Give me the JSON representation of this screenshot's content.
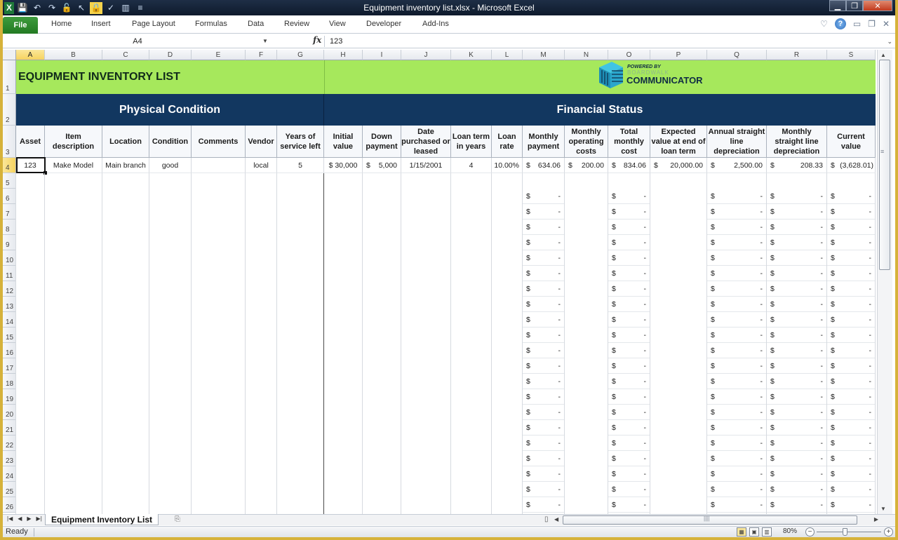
{
  "window": {
    "title": "Equipment inventory list.xlsx  -  Microsoft Excel",
    "controls": [
      "minimize",
      "maximize",
      "close"
    ]
  },
  "quick_access": [
    {
      "name": "excel-logo",
      "glyph": "X"
    },
    {
      "name": "save-icon",
      "glyph": "▪"
    },
    {
      "name": "undo-icon",
      "glyph": "↶"
    },
    {
      "name": "redo-icon",
      "glyph": "↷"
    },
    {
      "name": "lock-icon",
      "glyph": "🔒"
    },
    {
      "name": "pointer-icon",
      "glyph": "↖"
    },
    {
      "name": "lock-highlight-icon",
      "glyph": "🔒"
    },
    {
      "name": "brush-icon",
      "glyph": "✓"
    },
    {
      "name": "chart-icon",
      "glyph": "▥"
    },
    {
      "name": "customize-icon",
      "glyph": "≡"
    }
  ],
  "ribbon": {
    "file": "File",
    "tabs": [
      "Home",
      "Insert",
      "Page Layout",
      "Formulas",
      "Data",
      "Review",
      "View",
      "Developer",
      "Add-Ins"
    ]
  },
  "formula_bar": {
    "name_box": "A4",
    "fx": "fx",
    "value": "123"
  },
  "columns": [
    "A",
    "B",
    "C",
    "D",
    "E",
    "F",
    "G",
    "H",
    "I",
    "J",
    "K",
    "L",
    "M",
    "N",
    "O",
    "P",
    "Q",
    "R",
    "S"
  ],
  "selected_column": "A",
  "selected_row": 4,
  "rows_visible": [
    1,
    2,
    3,
    4,
    5,
    6,
    7,
    8,
    9,
    10,
    11,
    12,
    13,
    14,
    15,
    16,
    17,
    18,
    19,
    20,
    21,
    22,
    23,
    24,
    25,
    26
  ],
  "sheet": {
    "title": "EQUIPMENT INVENTORY LIST",
    "logo": {
      "powered_by": "POWERED BY",
      "brand": "BOARDWALK",
      "product": "COMMUNICATOR"
    },
    "section_physical": "Physical Condition",
    "section_financial": "Financial Status",
    "headers": [
      "Asset",
      "Item description",
      "Location",
      "Condition",
      "Comments",
      "Vendor",
      "Years of service left",
      "Initial value",
      "Down payment",
      "Date purchased or leased",
      "Loan term in years",
      "Loan rate",
      "Monthly payment",
      "Monthly operating costs",
      "Total monthly cost",
      "Expected value at end of loan term",
      "Annual straight line depreciation",
      "Monthly straight line depreciation",
      "Current value"
    ],
    "data_row": {
      "asset": "123",
      "item_description": "Make Model",
      "location": "Main branch",
      "condition": "good",
      "comments": "",
      "vendor": "local",
      "years_of_service_left": "5",
      "initial_value": "$ 30,000",
      "down_payment_cur": "$",
      "down_payment": "5,000",
      "date_purchased": "1/15/2001",
      "loan_term": "4",
      "loan_rate": "10.00%",
      "monthly_payment_cur": "$",
      "monthly_payment": "634.06",
      "monthly_operating_cur": "$",
      "monthly_operating": "200.00",
      "total_monthly_cur": "$",
      "total_monthly": "834.06",
      "expected_value_cur": "$",
      "expected_value": "20,000.00",
      "annual_dep_cur": "$",
      "annual_dep": "2,500.00",
      "monthly_dep_cur": "$",
      "monthly_dep": "208.33",
      "current_value_cur": "$",
      "current_value": "(3,628.01)"
    },
    "empty_currency": {
      "cur": "$",
      "amt": "-"
    }
  },
  "sheet_tabs": {
    "active": "Equipment Inventory List",
    "nav": [
      "◀◀",
      "◀",
      "▶",
      "▶▶"
    ]
  },
  "status": {
    "ready": "Ready",
    "zoom": "80%",
    "zoom_fraction": 0.45
  }
}
